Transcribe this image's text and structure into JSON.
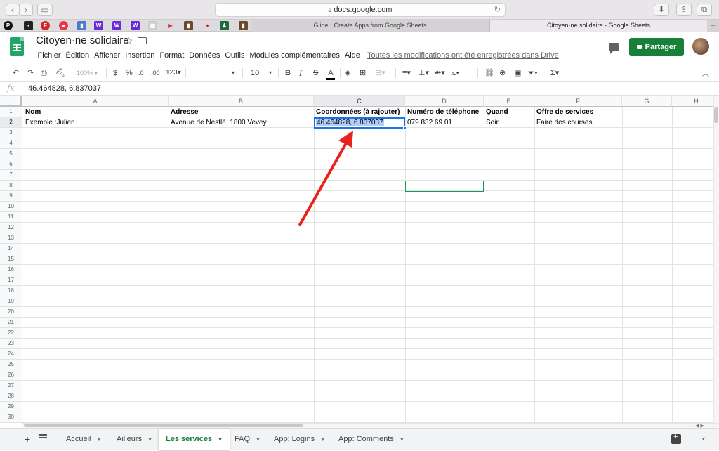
{
  "browser": {
    "url": "docs.google.com",
    "tabs": [
      "Glide · Create Apps from Google Sheets",
      "Citoyen·ne solidaire - Google Sheets"
    ],
    "new_tab_label": "+"
  },
  "document": {
    "title": "Citoyen·ne solidaire",
    "menu": [
      "Fichier",
      "Édition",
      "Afficher",
      "Insertion",
      "Format",
      "Données",
      "Outils",
      "Modules complémentaires",
      "Aide"
    ],
    "save_status": "Toutes les modifications ont été enregistrées dans Drive",
    "share_label": "Partager"
  },
  "toolbar": {
    "zoom": "100%",
    "currency": "$",
    "percent": "%",
    "decrease_decimals": ".0",
    "increase_decimals": ".00",
    "number_format": "123",
    "font_size": "10",
    "bold": "B",
    "italic": "I",
    "strikethrough": "S",
    "text_color": "A"
  },
  "formula_bar": {
    "fx_label": "fx",
    "value": "46.464828, 6.837037"
  },
  "grid": {
    "column_letters": [
      "A",
      "B",
      "C",
      "D",
      "E",
      "F",
      "G",
      "H"
    ],
    "selected_column": "C",
    "row_numbers": [
      "1",
      "2",
      "3",
      "4",
      "5",
      "6",
      "7",
      "8",
      "9",
      "10",
      "11",
      "12",
      "13",
      "14",
      "15",
      "16",
      "17",
      "18",
      "19",
      "20",
      "21",
      "22",
      "23",
      "24",
      "25",
      "26",
      "27",
      "28",
      "29",
      "30"
    ],
    "header_row": [
      "Nom",
      "Adresse",
      "Coordonnées (à rajouter)",
      "Numéro de téléphone",
      "Quand",
      "Offre de services"
    ],
    "data_row": [
      "Exemple :Julien",
      "Avenue de Nestlé, 1800 Vevey",
      "46.464828, 6.837037",
      "079 832 69 01",
      "Soir",
      "Faire des courses"
    ],
    "selected_cell": "C2",
    "active_cell": "D8"
  },
  "sheet_tabs": [
    {
      "label": "Accueil",
      "active": false
    },
    {
      "label": "Ailleurs",
      "active": false
    },
    {
      "label": "Les services",
      "active": true
    },
    {
      "label": "FAQ",
      "active": false
    },
    {
      "label": "App: Logins",
      "active": false
    },
    {
      "label": "App: Comments",
      "active": false
    }
  ],
  "colors": {
    "share_button": "#188038",
    "annotation_arrow": "#e8231c",
    "selection_border": "#1a73e8",
    "active_cell_border": "#0f9d58"
  }
}
